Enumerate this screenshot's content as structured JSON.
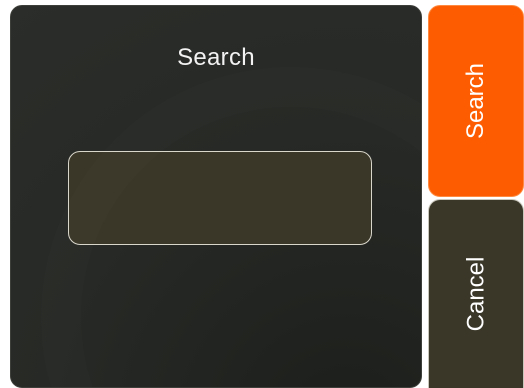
{
  "dialog": {
    "title": "Search",
    "input": {
      "value": "",
      "placeholder": ""
    }
  },
  "actions": {
    "search_label": "Search",
    "cancel_label": "Cancel"
  },
  "colors": {
    "search_button": "#fd5d00",
    "panel_background": "#2a2c29",
    "input_background": "#3a3729",
    "cancel_button": "#3a3729"
  }
}
